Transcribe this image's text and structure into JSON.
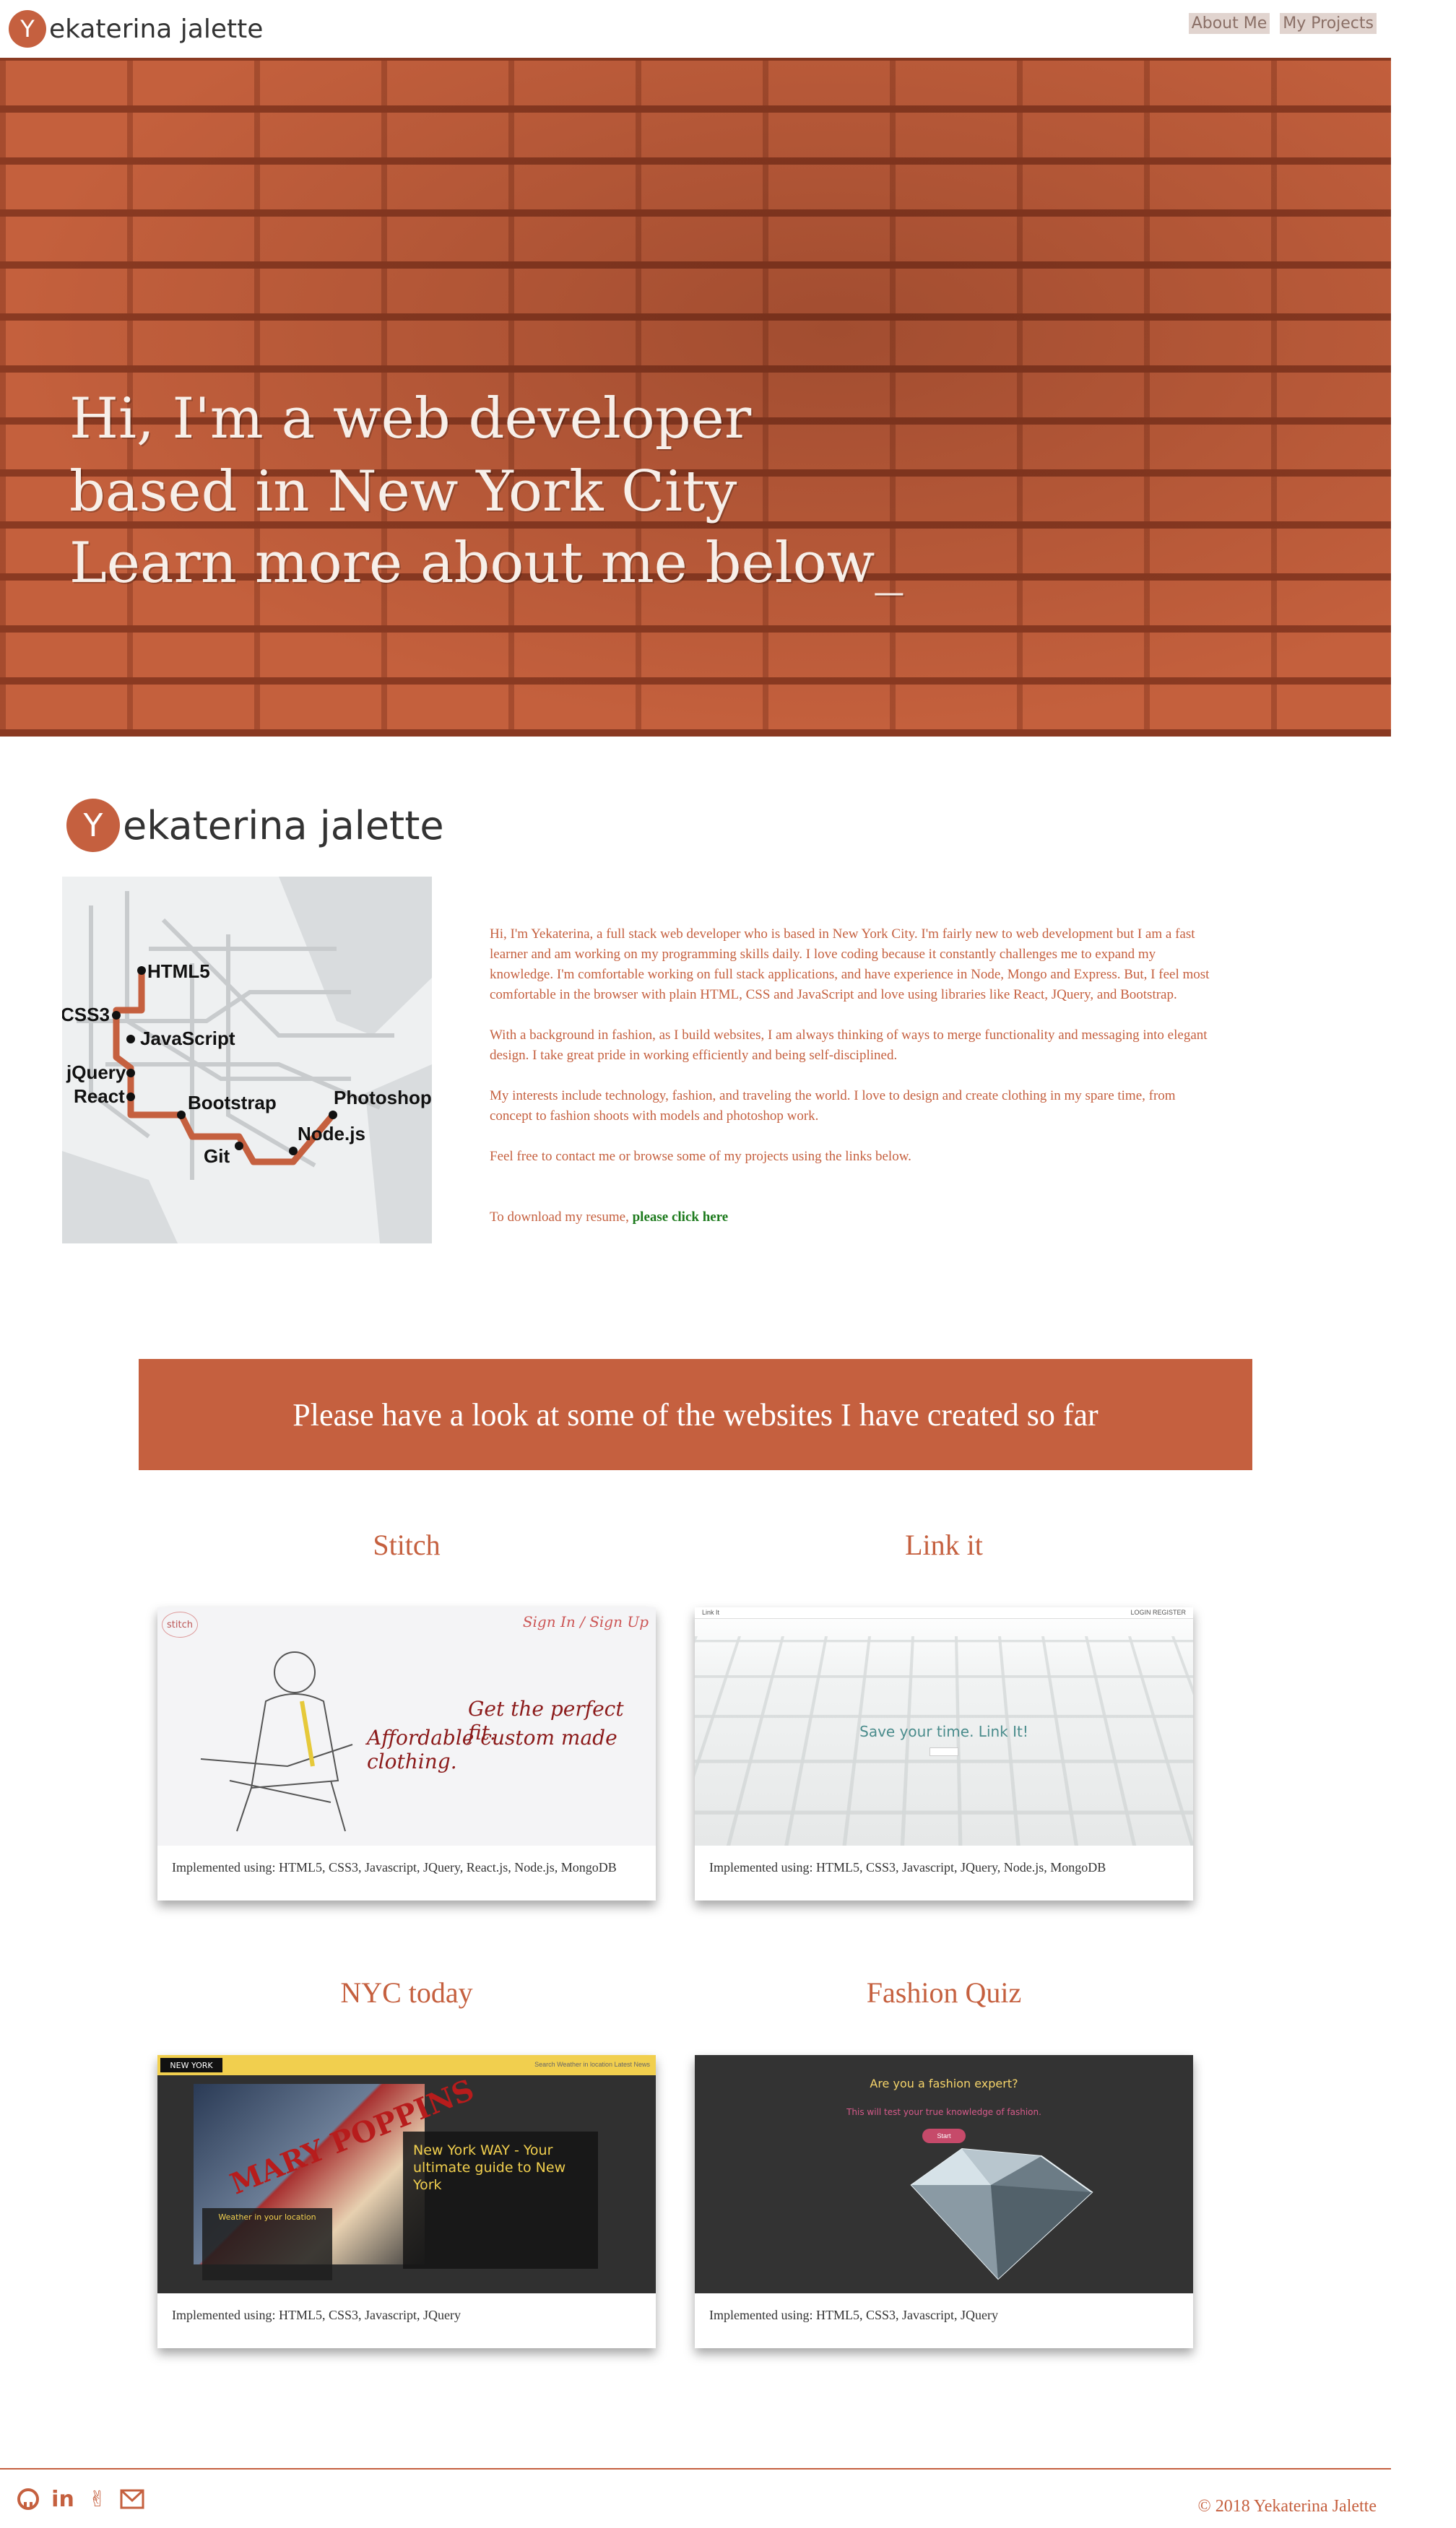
{
  "nav": {
    "brand_initial": "Y",
    "brand_text": "ekaterina jalette",
    "links": [
      "About Me",
      "My Projects"
    ]
  },
  "hero": {
    "lines": [
      "Hi, I'm a web developer",
      "based in New York City",
      "Learn more about me below_"
    ]
  },
  "about": {
    "brand_initial": "Y",
    "brand_text": "ekaterina jalette",
    "map_labels": [
      "HTML5",
      "CSS3",
      "JavaScript",
      "jQuery",
      "React",
      "Bootstrap",
      "Photoshop",
      "Node.js",
      "Git"
    ],
    "paragraphs": [
      "Hi, I'm Yekaterina, a full stack web developer who is based in New York City. I'm fairly new to web development but I am a fast learner and am working on my programming skills daily. I love coding because it constantly challenges me to expand my knowledge. I'm comfortable working on full stack applications, and have experience in Node, Mongo and Express. But, I feel most comfortable in the browser with plain HTML, CSS and JavaScript and love using libraries like React, JQuery, and Bootstrap.",
      "With a background in fashion, as I build websites, I am always thinking of ways to merge functionality and messaging into elegant design. I take great pride in working efficiently and being self-disciplined.",
      "My interests include technology, fashion, and traveling the world. I love to design and create clothing in my spare time, from concept to fashion shoots with models and photoshop work.",
      "Feel free to contact me or browse some of my projects using the links below."
    ],
    "resume_prefix": "To download my resume, ",
    "resume_link": "please click here"
  },
  "projects": {
    "banner": "Please have a look at some of the websites I have created so far",
    "items": [
      {
        "title": "Stitch",
        "implemented": "Implemented using: HTML5, CSS3, Javascript, JQuery, React.js, Node.js, MongoDB",
        "shot": {
          "logo": "stitch",
          "signin": "Sign In / Sign Up",
          "tag1": "Get the perfect fit.",
          "tag2": "Affordable custom made clothing."
        }
      },
      {
        "title": "Link it",
        "implemented": "Implemented using: HTML5, CSS3, Javascript, JQuery, Node.js, MongoDB",
        "shot": {
          "tl": "Link It",
          "tr": "LOGIN  REGISTER",
          "tagline": "Save your time. Link It!"
        }
      },
      {
        "title": "NYC today",
        "implemented": "Implemented using: HTML5, CSS3, Javascript, JQuery",
        "shot": {
          "sign": "NEW YORK",
          "menu": "Search   Weather in location   Latest News",
          "poster": "MARY POPPINS",
          "weather": "Weather in your location",
          "way": "New York WAY - Your ultimate guide to New York"
        }
      },
      {
        "title": "Fashion Quiz",
        "implemented": "Implemented using: HTML5, CSS3, Javascript, JQuery",
        "shot": {
          "q1": "Are you a fashion expert?",
          "q2": "This will test your true knowledge of fashion.",
          "start": "Start"
        }
      }
    ]
  },
  "footer": {
    "social": [
      "github-icon",
      "linkedin-icon",
      "angellist-icon",
      "mail-icon"
    ],
    "copyright": "© 2018 Yekaterina Jalette"
  },
  "colors": {
    "accent": "#c5603f",
    "resume_link": "#1c7a1c"
  }
}
